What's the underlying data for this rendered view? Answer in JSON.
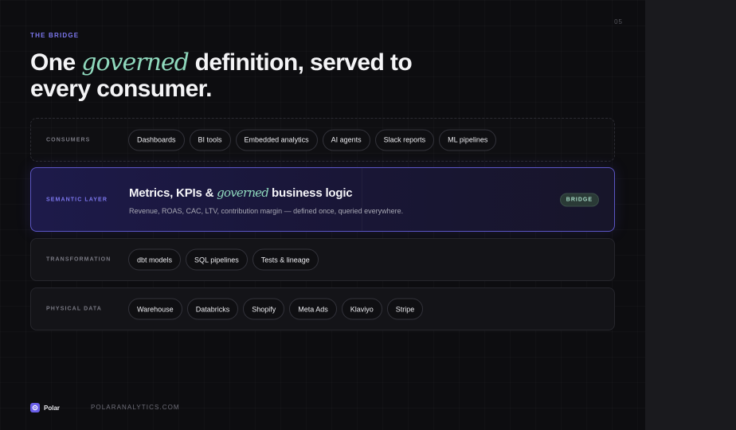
{
  "page": {
    "number": "05",
    "eyebrow": "THE BRIDGE",
    "headline": {
      "before": "One ",
      "accent": "governed",
      "after": " definition, served to every consumer."
    }
  },
  "layers": {
    "consumers": {
      "label": "CONSUMERS",
      "chips": [
        "Dashboards",
        "BI tools",
        "Embedded analytics",
        "AI agents",
        "Slack reports",
        "ML pipelines"
      ]
    },
    "semantic": {
      "label": "SEMANTIC LAYER",
      "title_before": "Metrics, KPIs & ",
      "title_accent": "governed",
      "title_after": " business logic",
      "description": "Revenue, ROAS, CAC, LTV, contribution margin — defined once, queried everywhere.",
      "badge": "BRIDGE"
    },
    "transformation": {
      "label": "TRANSFORMATION",
      "chips": [
        "dbt models",
        "SQL pipelines",
        "Tests & lineage"
      ]
    },
    "physical": {
      "label": "PHYSICAL DATA",
      "chips": [
        "Warehouse",
        "Databricks",
        "Shopify",
        "Meta Ads",
        "Klaviyo",
        "Stripe"
      ]
    }
  },
  "footer": {
    "brand": "Polar",
    "brand_icon": "polar-logo-icon",
    "url": "POLARANALYTICS.COM"
  },
  "colors": {
    "accent_purple": "#7d78f0",
    "accent_green": "#8fd9bd",
    "background": "#0d0d10"
  }
}
